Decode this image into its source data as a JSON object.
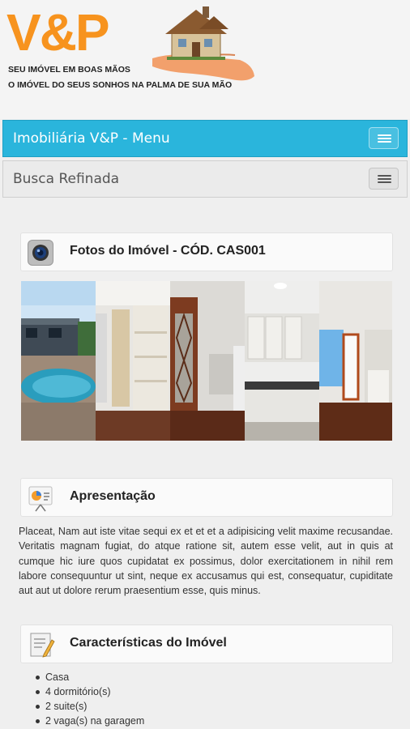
{
  "header": {
    "logo": "V&P",
    "slogan_line1": "SEU IMÓVEL EM BOAS MÃOS",
    "slogan_line2": "O IMÓVEL DO SEUS SONHOS NA PALMA DE SUA MÃO"
  },
  "menu_bar": {
    "label": "Imobiliária V&P - Menu",
    "toggle_icon": "menu-icon"
  },
  "search_bar": {
    "label": "Busca Refinada",
    "toggle_icon": "menu-icon"
  },
  "photos_section": {
    "title": "Fotos do Imóvel - CÓD. CAS001",
    "icon": "camera-icon",
    "photos": [
      "pool",
      "closet",
      "hallway",
      "kitchen",
      "living-room"
    ]
  },
  "presentation_section": {
    "title": "Apresentação",
    "icon": "presentation-board-icon",
    "text": "Placeat, Nam aut iste vitae sequi ex et et et a adipisicing velit maxime recusandae. Veritatis magnam fugiat, do atque ratione sit, autem esse velit, aut in quis at cumque hic iure quos cupidatat ex possimus, dolor exercitationem in nihil rem labore consequuntur ut sint, neque ex accusamus qui est, consequatur, cupiditate aut aut ut dolore rerum praesentium esse, quis minus."
  },
  "features_section": {
    "title": "Características do Imóvel",
    "icon": "edit-document-icon",
    "items": [
      "Casa",
      "4 dormitório(s)",
      "2 suite(s)",
      "2 vaga(s) na garagem"
    ]
  }
}
